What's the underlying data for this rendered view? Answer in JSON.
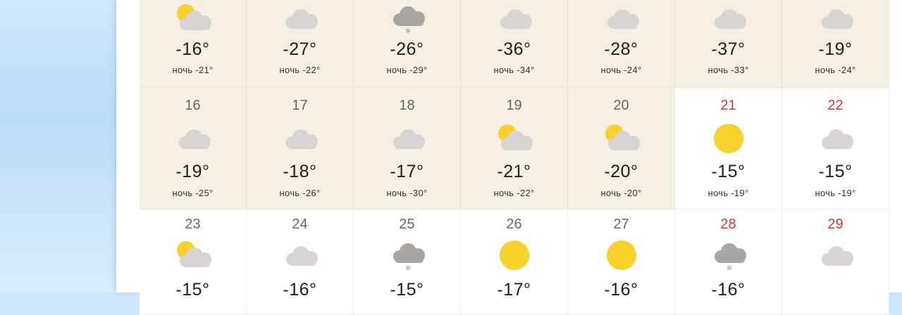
{
  "colors": {
    "past_bg": "#f6f0e4",
    "future_bg": "#ffffff",
    "weekend_day": "#d9362b",
    "sun": "#f7d22a",
    "cloud_light": "#d7d4d3",
    "cloud_dark": "#a8a5a3"
  },
  "weeks": [
    {
      "days": [
        {
          "day": "",
          "icon": "partly-cloudy-icon",
          "temp": "-16°",
          "night": "ночь -21°"
        },
        {
          "day": "",
          "icon": "cloudy-icon",
          "temp": "-27°",
          "night": "ночь -22°"
        },
        {
          "day": "",
          "icon": "snow-cloud-icon",
          "temp": "-26°",
          "night": "ночь -29°"
        },
        {
          "day": "",
          "icon": "cloudy-icon",
          "temp": "-36°",
          "night": "ночь -34°"
        },
        {
          "day": "",
          "icon": "cloudy-icon",
          "temp": "-28°",
          "night": "ночь -24°"
        },
        {
          "day": "",
          "icon": "cloudy-icon",
          "temp": "-37°",
          "night": "ночь -33°"
        },
        {
          "day": "",
          "icon": "cloudy-icon",
          "temp": "-19°",
          "night": "ночь -24°"
        }
      ]
    },
    {
      "days": [
        {
          "day": "16",
          "icon": "cloudy-icon",
          "temp": "-19°",
          "night": "ночь -25°"
        },
        {
          "day": "17",
          "icon": "cloudy-icon",
          "temp": "-18°",
          "night": "ночь -26°"
        },
        {
          "day": "18",
          "icon": "cloudy-icon",
          "temp": "-17°",
          "night": "ночь -30°"
        },
        {
          "day": "19",
          "icon": "partly-cloudy-icon",
          "temp": "-21°",
          "night": "ночь -22°"
        },
        {
          "day": "20",
          "icon": "partly-cloudy-icon",
          "temp": "-20°",
          "night": "ночь -20°"
        },
        {
          "day": "21",
          "icon": "sun-icon",
          "temp": "-15°",
          "night": "ночь -19°",
          "weekend": true
        },
        {
          "day": "22",
          "icon": "cloudy-icon",
          "temp": "-15°",
          "night": "ночь -19°",
          "weekend": true
        }
      ]
    },
    {
      "days": [
        {
          "day": "23",
          "icon": "partly-cloudy-icon",
          "temp": "-15°"
        },
        {
          "day": "24",
          "icon": "cloudy-icon",
          "temp": "-16°"
        },
        {
          "day": "25",
          "icon": "snow-cloud-icon",
          "temp": "-15°"
        },
        {
          "day": "26",
          "icon": "sun-icon",
          "temp": "-17°"
        },
        {
          "day": "27",
          "icon": "sun-icon",
          "temp": "-16°"
        },
        {
          "day": "28",
          "icon": "snow-cloud-icon",
          "temp": "-16°",
          "weekend": true
        },
        {
          "day": "29",
          "icon": "cloudy-icon",
          "temp": "",
          "weekend": true
        }
      ]
    }
  ]
}
